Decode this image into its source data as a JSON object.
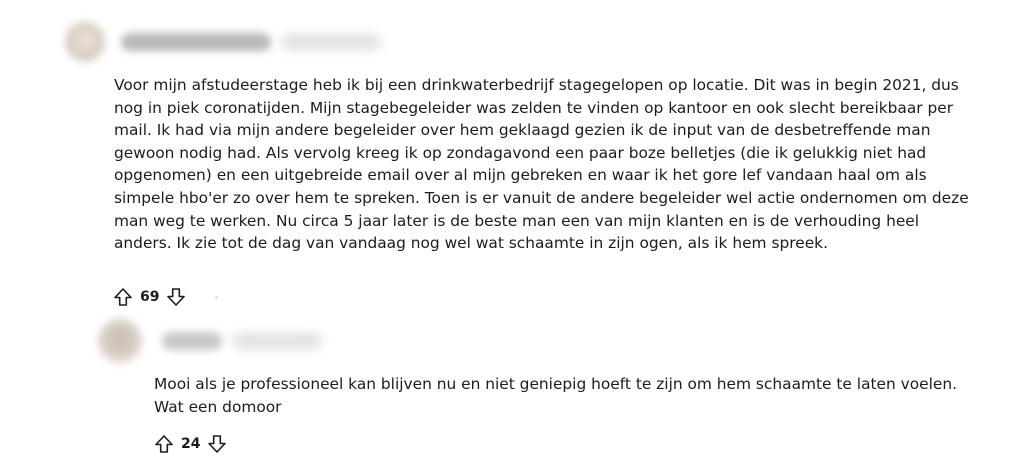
{
  "comments": [
    {
      "author": "",
      "body_lines": [
        "Voor mijn afstudeerstage heb ik bij een drinkwaterbedrijf stagegelopen op locatie. Dit was in begin 2021, dus",
        "nog in piek coronatijden. Mijn stagebegeleider was zelden te vinden op kantoor en ook slecht bereikbaar per",
        "mail. Ik had via mijn andere begeleider over hem geklaagd gezien ik de input van de desbetreffende man",
        "gewoon nodig had. Als vervolg kreeg ik op zondagavond een paar boze belletjes (die ik gelukkig niet had",
        "opgenomen) en een uitgebreide email over al mijn gebreken en waar ik het gore lef vandaan haal om als",
        "simpele hbo'er zo over hem te spreken. Toen is er vanuit de andere begeleider wel actie ondernomen om deze",
        "man weg te werken. Nu circa 5 jaar later is de beste man een van mijn klanten en is de verhouding heel",
        "anders. Ik zie tot de dag van vandaag nog wel wat schaamte in zijn ogen, als ik hem spreek."
      ],
      "votes": "69",
      "upvote_icon": "arrow-up-outline-icon",
      "downvote_icon": "arrow-down-outline-icon"
    },
    {
      "author": "",
      "body_lines": [
        "Mooi als je professioneel kan blijven nu en niet geniepig hoeft te zijn om hem schaamte te laten voelen.",
        "Wat een domoor"
      ],
      "votes": "24",
      "upvote_icon": "arrow-up-outline-icon",
      "downvote_icon": "arrow-down-outline-icon"
    }
  ],
  "colors": {
    "text": "#1c1c1c",
    "icon": "#1c1c1c",
    "background": "#ffffff"
  }
}
